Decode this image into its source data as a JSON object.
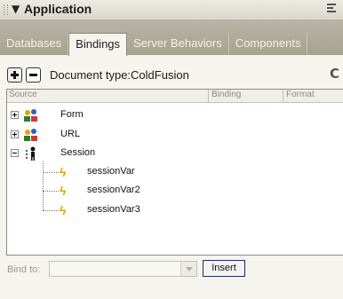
{
  "panel": {
    "title": "Application",
    "tabs": [
      {
        "label": "Databases",
        "active": false
      },
      {
        "label": "Bindings",
        "active": true
      },
      {
        "label": "Server Behaviors",
        "active": false
      },
      {
        "label": "Components",
        "active": false
      }
    ]
  },
  "toolbar": {
    "document_type": "Document type:ColdFusion",
    "add_icon": "plus-icon",
    "remove_icon": "minus-icon",
    "refresh_icon": "refresh-icon"
  },
  "list": {
    "columns": {
      "source": "Source",
      "binding": "Binding",
      "format": "Format"
    },
    "items": [
      {
        "label": "Form",
        "icon": "form-icon",
        "expanded": false
      },
      {
        "label": "URL",
        "icon": "url-icon",
        "expanded": false
      },
      {
        "label": "Session",
        "icon": "session-icon",
        "expanded": true
      },
      {
        "label": "sessionVar",
        "icon": "lightning-icon"
      },
      {
        "label": "sessionVar2",
        "icon": "lightning-icon"
      },
      {
        "label": "sessionVar3",
        "icon": "lightning-icon"
      }
    ]
  },
  "footer": {
    "bind_to_label": "Bind to:",
    "bind_to_value": "",
    "insert_label": "Insert"
  },
  "colors": {
    "tab_bar": "#aeab98",
    "panel_bg": "#f5f4ee",
    "list_bg": "#ffffff"
  }
}
